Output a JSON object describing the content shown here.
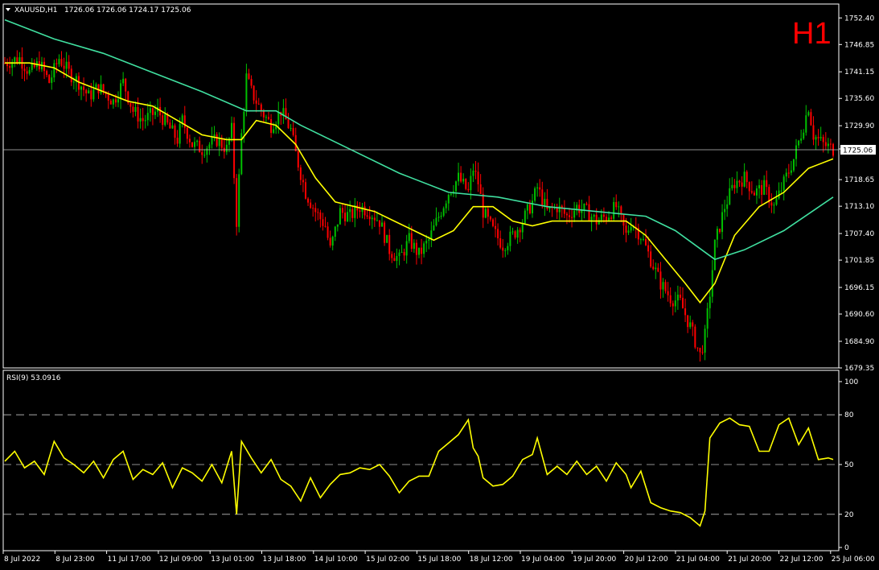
{
  "header": {
    "symbol": "XAUUSD,H1",
    "ohlc": "1726.06 1726.06 1724.17 1725.06",
    "timeframe_badge": "H1"
  },
  "rsi_header": "RSI(9) 53.0916",
  "price_tag": "1725.06",
  "colors": {
    "background": "#000000",
    "bull": "#00c000",
    "bear": "#ff0000",
    "fast_ma": "#ffff00",
    "slow_ma": "#40e0a0",
    "rsi": "#ffff00",
    "grid": "#ffffff"
  },
  "chart_data": [
    {
      "type": "candlestick",
      "title": "XAUUSD,H1",
      "ylim": [
        1679.35,
        1755.3
      ],
      "y_ticks": [
        "1752.40",
        "1746.85",
        "1741.15",
        "1735.60",
        "1729.90",
        "1725.05",
        "1718.65",
        "1713.10",
        "1707.40",
        "1701.85",
        "1696.15",
        "1690.60",
        "1684.90",
        "1679.35"
      ],
      "x_ticks": [
        "8 Jul 2022",
        "8 Jul 23:00",
        "11 Jul 17:00",
        "12 Jul 09:00",
        "13 Jul 01:00",
        "13 Jul 18:00",
        "14 Jul 10:00",
        "15 Jul 02:00",
        "15 Jul 18:00",
        "18 Jul 12:00",
        "19 Jul 04:00",
        "19 Jul 20:00",
        "20 Jul 12:00",
        "21 Jul 04:00",
        "21 Jul 20:00",
        "22 Jul 12:00",
        "25 Jul 06:00"
      ],
      "current_price": 1725.06,
      "close_path": [
        [
          0,
          1743
        ],
        [
          6,
          1744
        ],
        [
          10,
          1741
        ],
        [
          14,
          1743
        ],
        [
          18,
          1739
        ],
        [
          22,
          1744
        ],
        [
          26,
          1741
        ],
        [
          30,
          1739
        ],
        [
          34,
          1736
        ],
        [
          38,
          1738
        ],
        [
          44,
          1735
        ],
        [
          48,
          1739
        ],
        [
          52,
          1733
        ],
        [
          56,
          1731
        ],
        [
          62,
          1733
        ],
        [
          66,
          1730
        ],
        [
          70,
          1727
        ],
        [
          72,
          1731
        ],
        [
          76,
          1726
        ],
        [
          80,
          1725
        ],
        [
          86,
          1727
        ],
        [
          90,
          1725
        ],
        [
          92,
          1729
        ],
        [
          94,
          1710
        ],
        [
          96,
          1728
        ],
        [
          98,
          1740
        ],
        [
          100,
          1737
        ],
        [
          104,
          1733
        ],
        [
          108,
          1730
        ],
        [
          112,
          1733
        ],
        [
          116,
          1729
        ],
        [
          118,
          1724
        ],
        [
          122,
          1716
        ],
        [
          126,
          1712
        ],
        [
          130,
          1709
        ],
        [
          132,
          1704
        ],
        [
          136,
          1712
        ],
        [
          140,
          1711
        ],
        [
          144,
          1713
        ],
        [
          148,
          1712
        ],
        [
          152,
          1710
        ],
        [
          156,
          1704
        ],
        [
          160,
          1702
        ],
        [
          164,
          1706
        ],
        [
          168,
          1703
        ],
        [
          172,
          1706
        ],
        [
          176,
          1711
        ],
        [
          180,
          1716
        ],
        [
          184,
          1719
        ],
        [
          188,
          1716
        ],
        [
          190,
          1721
        ],
        [
          192,
          1718
        ],
        [
          194,
          1712
        ],
        [
          198,
          1708
        ],
        [
          202,
          1705
        ],
        [
          206,
          1707
        ],
        [
          210,
          1710
        ],
        [
          214,
          1714
        ],
        [
          216,
          1717
        ],
        [
          220,
          1712
        ],
        [
          224,
          1713
        ],
        [
          228,
          1711
        ],
        [
          232,
          1713
        ],
        [
          236,
          1712
        ],
        [
          240,
          1710
        ],
        [
          244,
          1711
        ],
        [
          248,
          1713
        ],
        [
          252,
          1707
        ],
        [
          254,
          1710
        ],
        [
          258,
          1707
        ],
        [
          262,
          1702
        ],
        [
          266,
          1697
        ],
        [
          270,
          1694
        ],
        [
          274,
          1693
        ],
        [
          278,
          1688
        ],
        [
          282,
          1682
        ],
        [
          284,
          1686
        ],
        [
          286,
          1695
        ],
        [
          288,
          1705
        ],
        [
          292,
          1713
        ],
        [
          296,
          1718
        ],
        [
          300,
          1719
        ],
        [
          304,
          1716
        ],
        [
          308,
          1717
        ],
        [
          312,
          1713
        ],
        [
          316,
          1718
        ],
        [
          320,
          1723
        ],
        [
          324,
          1730
        ],
        [
          326,
          1734
        ],
        [
          328,
          1728
        ],
        [
          332,
          1726
        ],
        [
          336,
          1725
        ]
      ],
      "series": [
        {
          "name": "",
          "color": "#ffff00",
          "values": [
            [
              0,
              1743
            ],
            [
              10,
              1743
            ],
            [
              20,
              1742
            ],
            [
              30,
              1739
            ],
            [
              40,
              1737
            ],
            [
              50,
              1735
            ],
            [
              60,
              1734
            ],
            [
              70,
              1731
            ],
            [
              80,
              1728
            ],
            [
              90,
              1727
            ],
            [
              96,
              1727
            ],
            [
              102,
              1731
            ],
            [
              110,
              1730
            ],
            [
              118,
              1726
            ],
            [
              126,
              1719
            ],
            [
              134,
              1714
            ],
            [
              142,
              1713
            ],
            [
              150,
              1712
            ],
            [
              158,
              1710
            ],
            [
              166,
              1708
            ],
            [
              174,
              1706
            ],
            [
              182,
              1708
            ],
            [
              190,
              1713
            ],
            [
              198,
              1713
            ],
            [
              206,
              1710
            ],
            [
              214,
              1709
            ],
            [
              222,
              1710
            ],
            [
              232,
              1710
            ],
            [
              242,
              1710
            ],
            [
              252,
              1710
            ],
            [
              260,
              1707
            ],
            [
              268,
              1702
            ],
            [
              276,
              1697
            ],
            [
              282,
              1693
            ],
            [
              288,
              1697
            ],
            [
              296,
              1707
            ],
            [
              306,
              1713
            ],
            [
              316,
              1716
            ],
            [
              326,
              1721
            ],
            [
              336,
              1723
            ]
          ]
        },
        {
          "name": "",
          "color": "#40e0a0",
          "values": [
            [
              0,
              1752
            ],
            [
              20,
              1748
            ],
            [
              40,
              1745
            ],
            [
              60,
              1741
            ],
            [
              80,
              1737
            ],
            [
              98,
              1733
            ],
            [
              110,
              1733
            ],
            [
              120,
              1730
            ],
            [
              140,
              1725
            ],
            [
              160,
              1720
            ],
            [
              180,
              1716
            ],
            [
              200,
              1715
            ],
            [
              220,
              1713
            ],
            [
              240,
              1712
            ],
            [
              260,
              1711
            ],
            [
              272,
              1708
            ],
            [
              288,
              1702
            ],
            [
              300,
              1704
            ],
            [
              316,
              1708
            ],
            [
              336,
              1715
            ]
          ]
        }
      ]
    },
    {
      "type": "line",
      "title": "RSI(9) 53.0916",
      "ylim": [
        0,
        100
      ],
      "y_ticks": [
        "100",
        "80",
        "50",
        "20",
        "0"
      ],
      "levels": [
        80,
        50,
        20
      ],
      "values": [
        [
          0,
          52
        ],
        [
          4,
          58
        ],
        [
          8,
          48
        ],
        [
          12,
          52
        ],
        [
          16,
          44
        ],
        [
          20,
          64
        ],
        [
          24,
          54
        ],
        [
          28,
          50
        ],
        [
          32,
          45
        ],
        [
          36,
          52
        ],
        [
          40,
          42
        ],
        [
          44,
          53
        ],
        [
          48,
          58
        ],
        [
          52,
          41
        ],
        [
          56,
          47
        ],
        [
          60,
          44
        ],
        [
          64,
          51
        ],
        [
          68,
          36
        ],
        [
          72,
          48
        ],
        [
          76,
          45
        ],
        [
          80,
          40
        ],
        [
          84,
          50
        ],
        [
          88,
          39
        ],
        [
          92,
          58
        ],
        [
          94,
          20
        ],
        [
          96,
          64
        ],
        [
          100,
          54
        ],
        [
          104,
          45
        ],
        [
          108,
          53
        ],
        [
          112,
          41
        ],
        [
          116,
          37
        ],
        [
          120,
          28
        ],
        [
          124,
          42
        ],
        [
          128,
          30
        ],
        [
          132,
          38
        ],
        [
          136,
          44
        ],
        [
          140,
          45
        ],
        [
          144,
          48
        ],
        [
          148,
          47
        ],
        [
          152,
          50
        ],
        [
          156,
          43
        ],
        [
          160,
          33
        ],
        [
          164,
          40
        ],
        [
          168,
          43
        ],
        [
          172,
          43
        ],
        [
          176,
          58
        ],
        [
          180,
          63
        ],
        [
          184,
          68
        ],
        [
          188,
          77
        ],
        [
          190,
          60
        ],
        [
          192,
          55
        ],
        [
          194,
          42
        ],
        [
          198,
          37
        ],
        [
          202,
          38
        ],
        [
          206,
          43
        ],
        [
          210,
          53
        ],
        [
          214,
          56
        ],
        [
          216,
          66
        ],
        [
          220,
          44
        ],
        [
          224,
          49
        ],
        [
          228,
          44
        ],
        [
          232,
          52
        ],
        [
          236,
          44
        ],
        [
          240,
          49
        ],
        [
          244,
          40
        ],
        [
          248,
          51
        ],
        [
          252,
          44
        ],
        [
          254,
          36
        ],
        [
          258,
          46
        ],
        [
          262,
          27
        ],
        [
          266,
          24
        ],
        [
          270,
          22
        ],
        [
          274,
          21
        ],
        [
          278,
          18
        ],
        [
          282,
          13
        ],
        [
          284,
          22
        ],
        [
          286,
          66
        ],
        [
          290,
          75
        ],
        [
          294,
          78
        ],
        [
          298,
          74
        ],
        [
          302,
          73
        ],
        [
          306,
          58
        ],
        [
          310,
          58
        ],
        [
          314,
          74
        ],
        [
          318,
          78
        ],
        [
          322,
          62
        ],
        [
          326,
          72
        ],
        [
          330,
          53
        ],
        [
          334,
          54
        ],
        [
          336,
          53
        ]
      ]
    }
  ]
}
